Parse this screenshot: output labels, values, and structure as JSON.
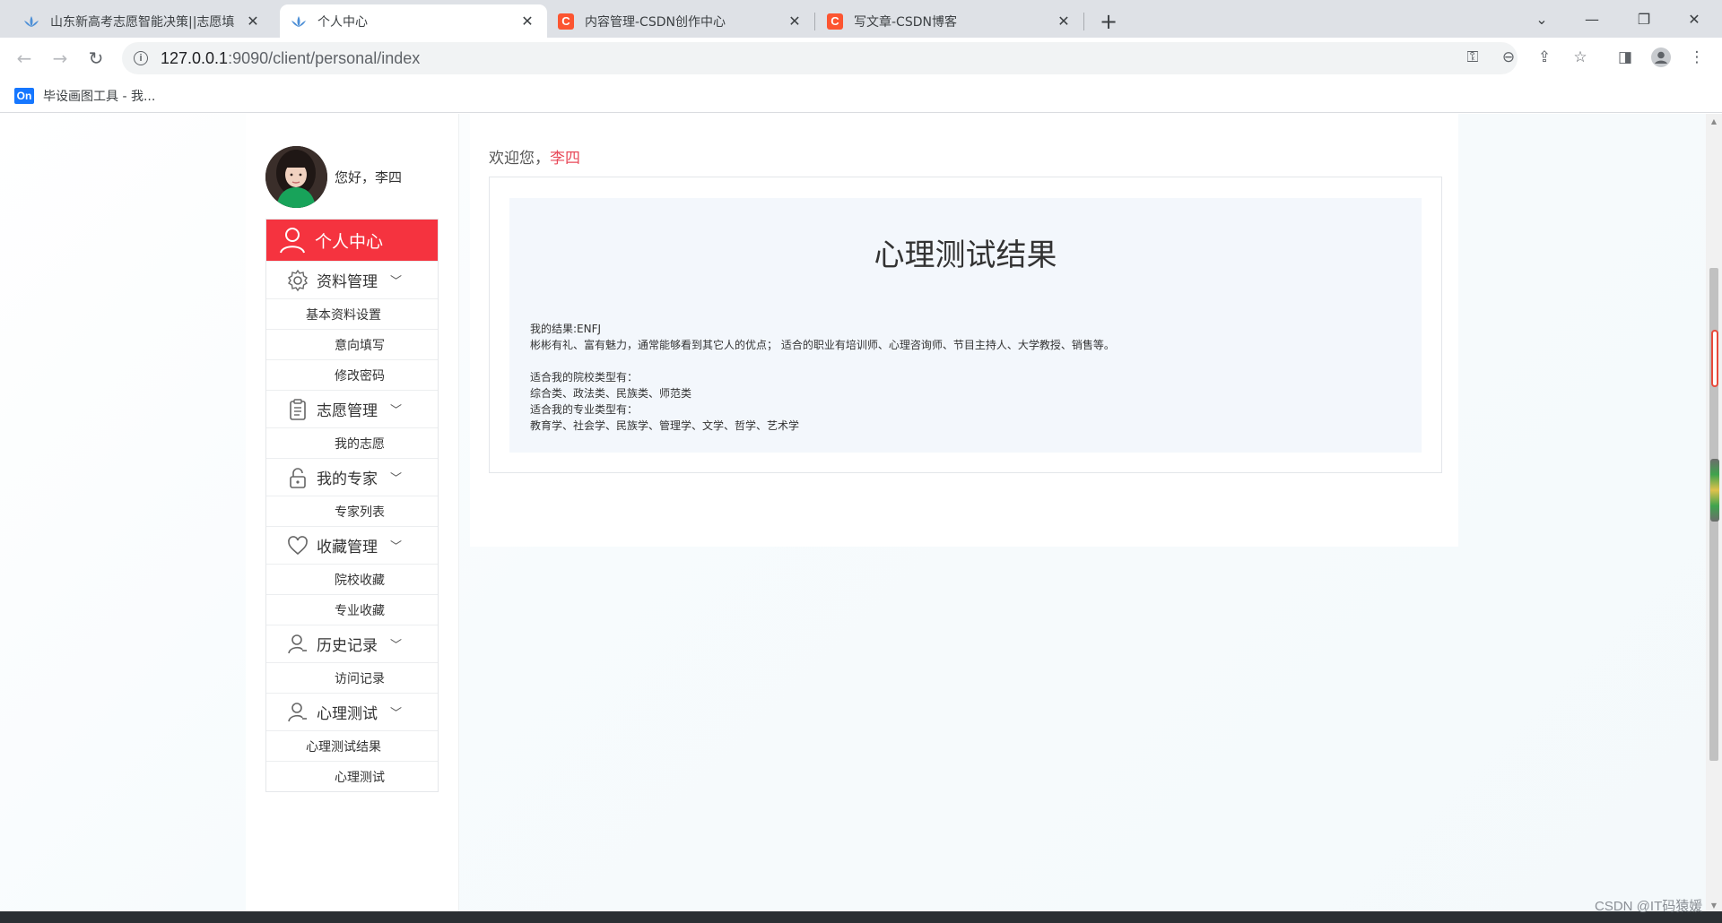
{
  "browser": {
    "tabs": [
      {
        "title": "山东新高考志愿智能决策||志愿填",
        "icon": "lotus-icon",
        "active": false
      },
      {
        "title": "个人中心",
        "icon": "lotus-icon",
        "active": true
      },
      {
        "title": "内容管理-CSDN创作中心",
        "icon": "csdn-icon",
        "active": false
      },
      {
        "title": "写文章-CSDN博客",
        "icon": "csdn-icon",
        "active": false
      }
    ],
    "csdn_letter": "C",
    "url_host": "127.0.0.1",
    "url_path": ":9090/client/personal/index",
    "bookmark": {
      "icon_text": "On",
      "label": "毕设画图工具 - 我..."
    }
  },
  "sidebar": {
    "greeting": "您好，李四",
    "header": {
      "label": "个人中心",
      "icon": "user-icon"
    },
    "groups": [
      {
        "label": "资料管理",
        "icon": "gear-icon",
        "items": [
          "基本资料设置",
          "意向填写",
          "修改密码"
        ]
      },
      {
        "label": "志愿管理",
        "icon": "clipboard-icon",
        "items": [
          "我的志愿"
        ]
      },
      {
        "label": "我的专家",
        "icon": "lock-icon",
        "items": [
          "专家列表"
        ]
      },
      {
        "label": "收藏管理",
        "icon": "heart-icon",
        "items": [
          "院校收藏",
          "专业收藏"
        ]
      },
      {
        "label": "历史记录",
        "icon": "user-icon",
        "items": [
          "访问记录"
        ]
      },
      {
        "label": "心理测试",
        "icon": "user-icon",
        "items": [
          "心理测试结果",
          "心理测试"
        ]
      }
    ]
  },
  "main": {
    "welcome_prefix": "欢迎您，",
    "welcome_name": "李四",
    "title": "心理测试结果",
    "lines": [
      "我的结果:ENFJ",
      "彬彬有礼、富有魅力，通常能够看到其它人的优点；  适合的职业有培训师、心理咨询师、节目主持人、大学教授、销售等。",
      "",
      "适合我的院校类型有：",
      "综合类、政法类、民族类、师范类",
      "适合我的专业类型有：",
      "教育学、社会学、民族学、管理学、文学、哲学、艺术学"
    ]
  },
  "watermark": "CSDN @IT码猿媛",
  "colors": {
    "accent": "#f5333f",
    "name": "#e84a5a",
    "result_bg": "#f3f7fc"
  }
}
